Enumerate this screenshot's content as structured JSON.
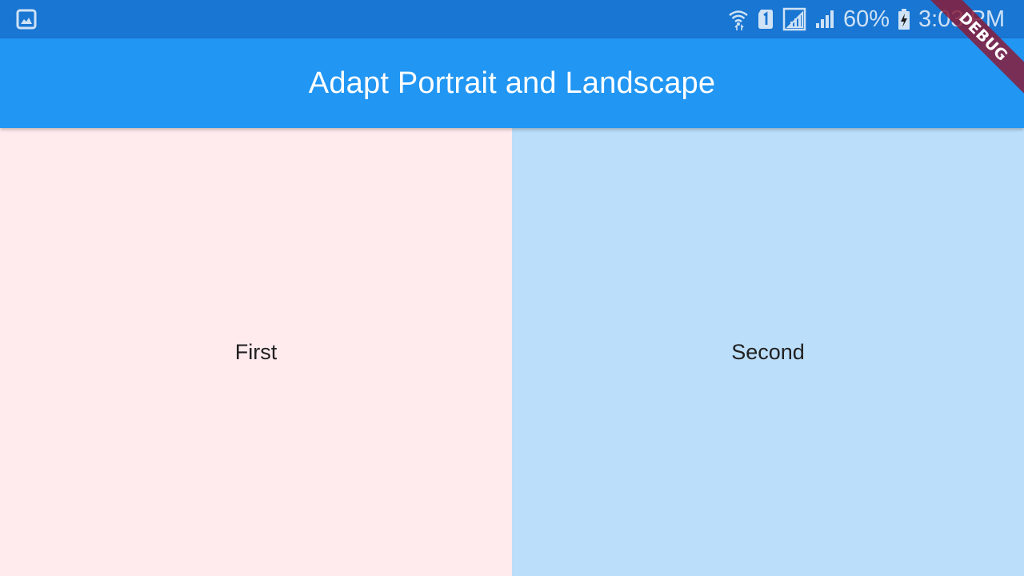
{
  "status_bar": {
    "notification_icon": "image-icon",
    "icons": [
      "wifi-icon",
      "sim-1-icon",
      "signal-outline-icon",
      "signal-icon"
    ],
    "battery_percent": "60%",
    "battery_icon": "battery-charging-icon",
    "time": "3:03 PM",
    "color": "#1976D2"
  },
  "app_bar": {
    "title": "Adapt Portrait and Landscape",
    "color": "#2196F3"
  },
  "panes": [
    {
      "label": "First",
      "color": "#FFEBEE"
    },
    {
      "label": "Second",
      "color": "#BBDEFB"
    }
  ],
  "debug_banner": {
    "label": "DEBUG"
  }
}
